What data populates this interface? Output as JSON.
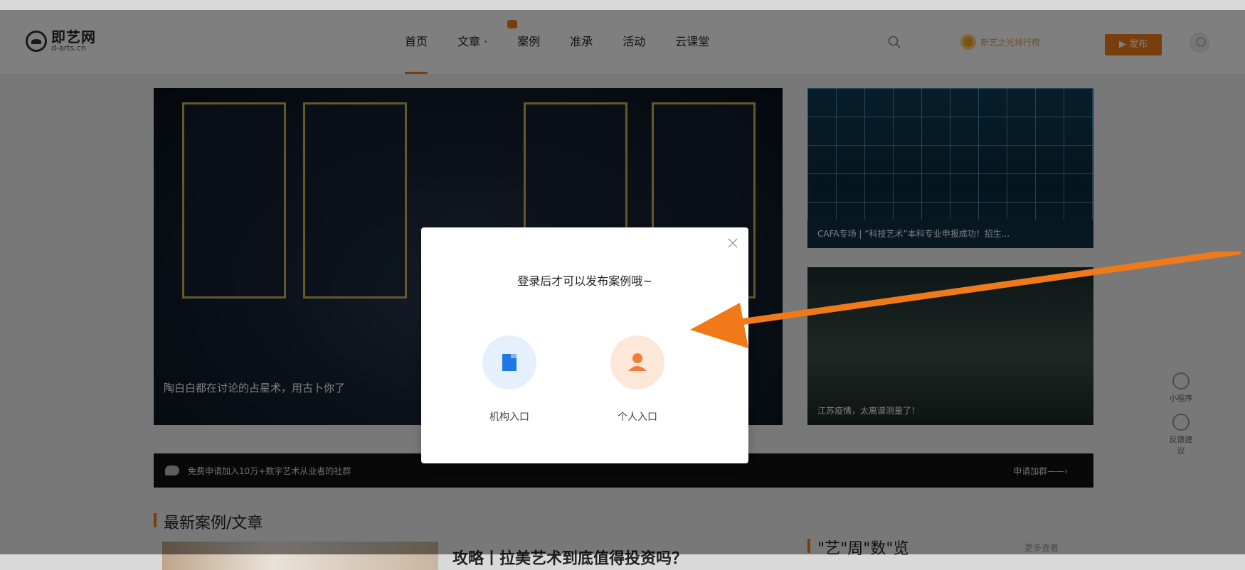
{
  "header": {
    "logo_cn": "即艺网",
    "logo_en": "d-arts.cn",
    "nav": [
      "首页",
      "文章 ·",
      "案例",
      "准承",
      "活动",
      "云课堂"
    ],
    "medal_text": "新艺之光排行榜",
    "publish_label": "发布"
  },
  "banners": {
    "hero_caption": "陶白白都在讨论的占星术，用古卜你了",
    "side_top_caption": "CAFA专场 | “科技艺术”本科专业申报成功！招生...",
    "side_bottom_caption": "江苏疫情，太离谱测量了！"
  },
  "notice": {
    "text": "免费申请加入10万+数字艺术从业者的社群",
    "link": "申请加群——›"
  },
  "sections": {
    "latest_title": "最新案例/文章",
    "article_title": "攻略丨拉美艺术到底值得投资吗？",
    "stats_title": "\"艺\"周\"数\"览",
    "stats_more": "更多查看"
  },
  "tools": {
    "mini_program": "小程序",
    "feedback": "反馈建议"
  },
  "modal": {
    "title": "登录后才可以发布案例哦~",
    "org_label": "机构入口",
    "personal_label": "个人入口"
  },
  "colors": {
    "accent": "#f07d18",
    "annotation": "#f07a1a",
    "org_icon": "#1e78e6",
    "personal_icon": "#f07d3a"
  }
}
